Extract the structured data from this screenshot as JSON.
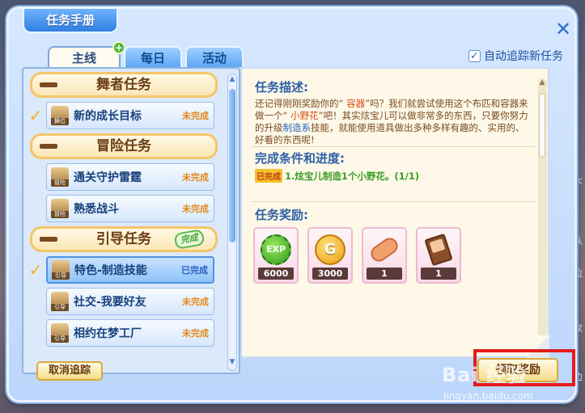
{
  "window": {
    "title": "任务手册",
    "close_glyph": "✕",
    "auto_track_label": "自动追踪新任务"
  },
  "tabs": [
    {
      "label": "主线",
      "active": true,
      "badge": "+"
    },
    {
      "label": "每日",
      "active": false
    },
    {
      "label": "活动",
      "active": false
    }
  ],
  "quest_list": {
    "categories": [
      {
        "title": "舞者任务",
        "done_stamp": ""
      },
      {
        "title": "冒险任务",
        "done_stamp": ""
      },
      {
        "title": "引导任务",
        "done_stamp": "完成"
      }
    ],
    "items": [
      {
        "name": "新的成长目标",
        "icon_tag": "舞位",
        "status": "未完成",
        "checked": true
      },
      {
        "name": "通关守护雷霆",
        "icon_tag": "冒险",
        "status": "未完成",
        "checked": false
      },
      {
        "name": "熟悉战斗",
        "icon_tag": "冒险",
        "status": "未完成",
        "checked": false
      },
      {
        "name": "特色-制造技能",
        "icon_tag": "引导",
        "status": "已完成",
        "checked": true,
        "selected": true
      },
      {
        "name": "社交-我要好友",
        "icon_tag": "引导",
        "status": "未完成",
        "checked": false
      },
      {
        "name": "相约在梦工厂",
        "icon_tag": "引导",
        "status": "未完成",
        "checked": false
      }
    ],
    "check_glyph": "✓"
  },
  "detail": {
    "desc_title": "任务描述:",
    "desc_parts": {
      "p1": "还记得刚刚奖励你的“ ",
      "container": "容器",
      "p2": "”吗？我们就尝试使用这个布匹和容器来做一个“ ",
      "flower": "小野花",
      "p3": "”吧！其实炫宝儿可以做非常多的东西，只要你努力的升级",
      "skill": "制造系",
      "p4": "技能，就能使用道具做出多种多样有趣的、实用的、好看的东西呢!"
    },
    "cond_title": "完成条件和进度:",
    "cond_badge": "已完成",
    "cond_text": "1.炫宝儿制造1个小野花。(1/1)",
    "reward_title": "任务奖励:",
    "rewards": [
      {
        "icon": "exp-coin-icon",
        "icon_text": "EXP",
        "count": "6000"
      },
      {
        "icon": "gold-coin-icon",
        "icon_text": "G",
        "count": "3000"
      },
      {
        "icon": "candy-icon",
        "icon_text": "",
        "count": "1"
      },
      {
        "icon": "chocolate-icon",
        "icon_text": "",
        "count": "1"
      }
    ]
  },
  "buttons": {
    "cancel_track": "取消追踪",
    "accept": "领取奖励"
  },
  "watermark": {
    "logo": "Bai 经验",
    "url": "jingyan.baidu.com"
  },
  "background": {
    "right_edge_text": [
      "大",
      "认",
      "拉",
      "家",
      "边"
    ]
  }
}
